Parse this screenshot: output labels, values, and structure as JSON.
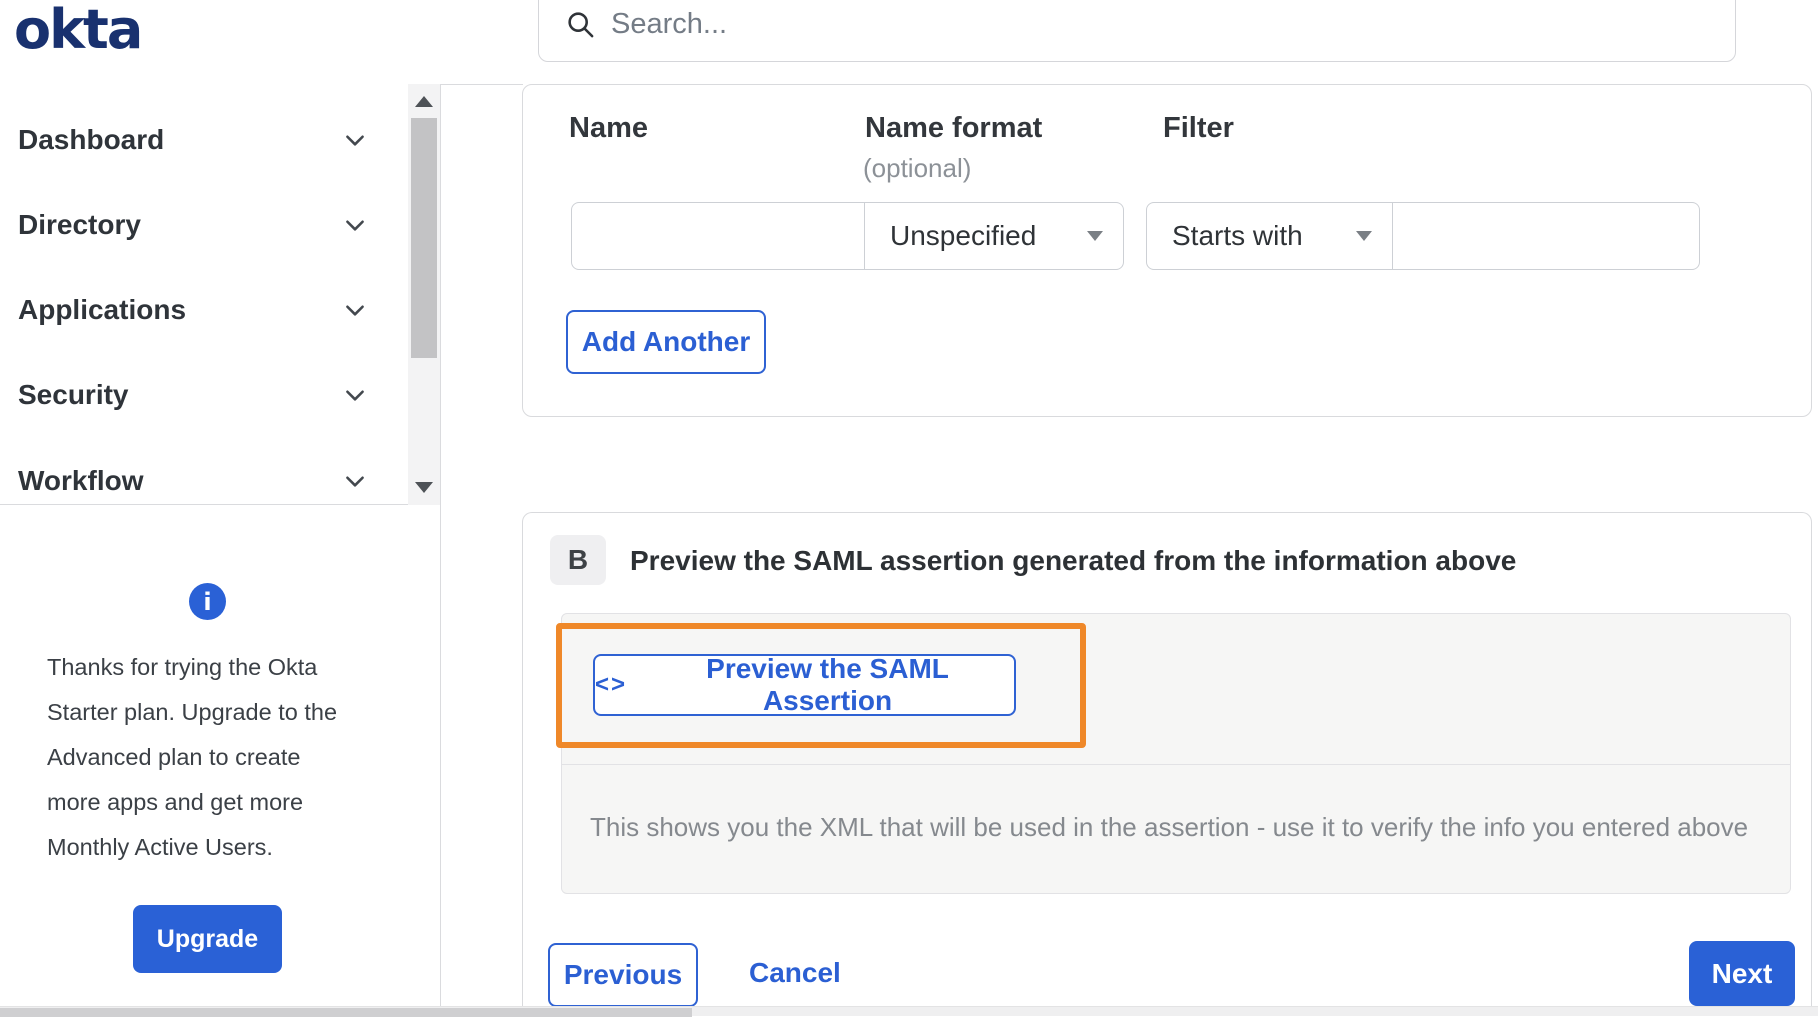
{
  "brand": {
    "logo_text": "okta"
  },
  "header": {
    "search_placeholder": "Search..."
  },
  "sidebar": {
    "items": [
      {
        "label": "Dashboard"
      },
      {
        "label": "Directory"
      },
      {
        "label": "Applications"
      },
      {
        "label": "Security"
      },
      {
        "label": "Workflow"
      }
    ],
    "info_icon_glyph": "i",
    "plan_notice": "Thanks for trying the Okta Starter plan. Upgrade to the Advanced plan to create more apps and get more Monthly Active Users.",
    "upgrade_label": "Upgrade"
  },
  "attribute_form": {
    "name_label": "Name",
    "name_format_label": "Name format",
    "name_format_hint": "(optional)",
    "filter_label": "Filter",
    "name_value": "",
    "name_format_selected": "Unspecified",
    "filter_type_selected": "Starts with",
    "filter_value": "",
    "add_another_label": "Add Another"
  },
  "preview_section": {
    "step_badge": "B",
    "title": "Preview the SAML assertion generated from the information above",
    "code_icon": "<>",
    "preview_button_label": "Preview the SAML Assertion",
    "help_text": "This shows you the XML that will be used in the assertion - use it to verify the info you entered above"
  },
  "footer": {
    "previous_label": "Previous",
    "cancel_label": "Cancel",
    "next_label": "Next"
  },
  "colors": {
    "primary_blue": "#2A61D6",
    "link_blue": "#2B5FD3",
    "highlight_orange": "#EF8829",
    "logo_navy": "#19316F"
  }
}
